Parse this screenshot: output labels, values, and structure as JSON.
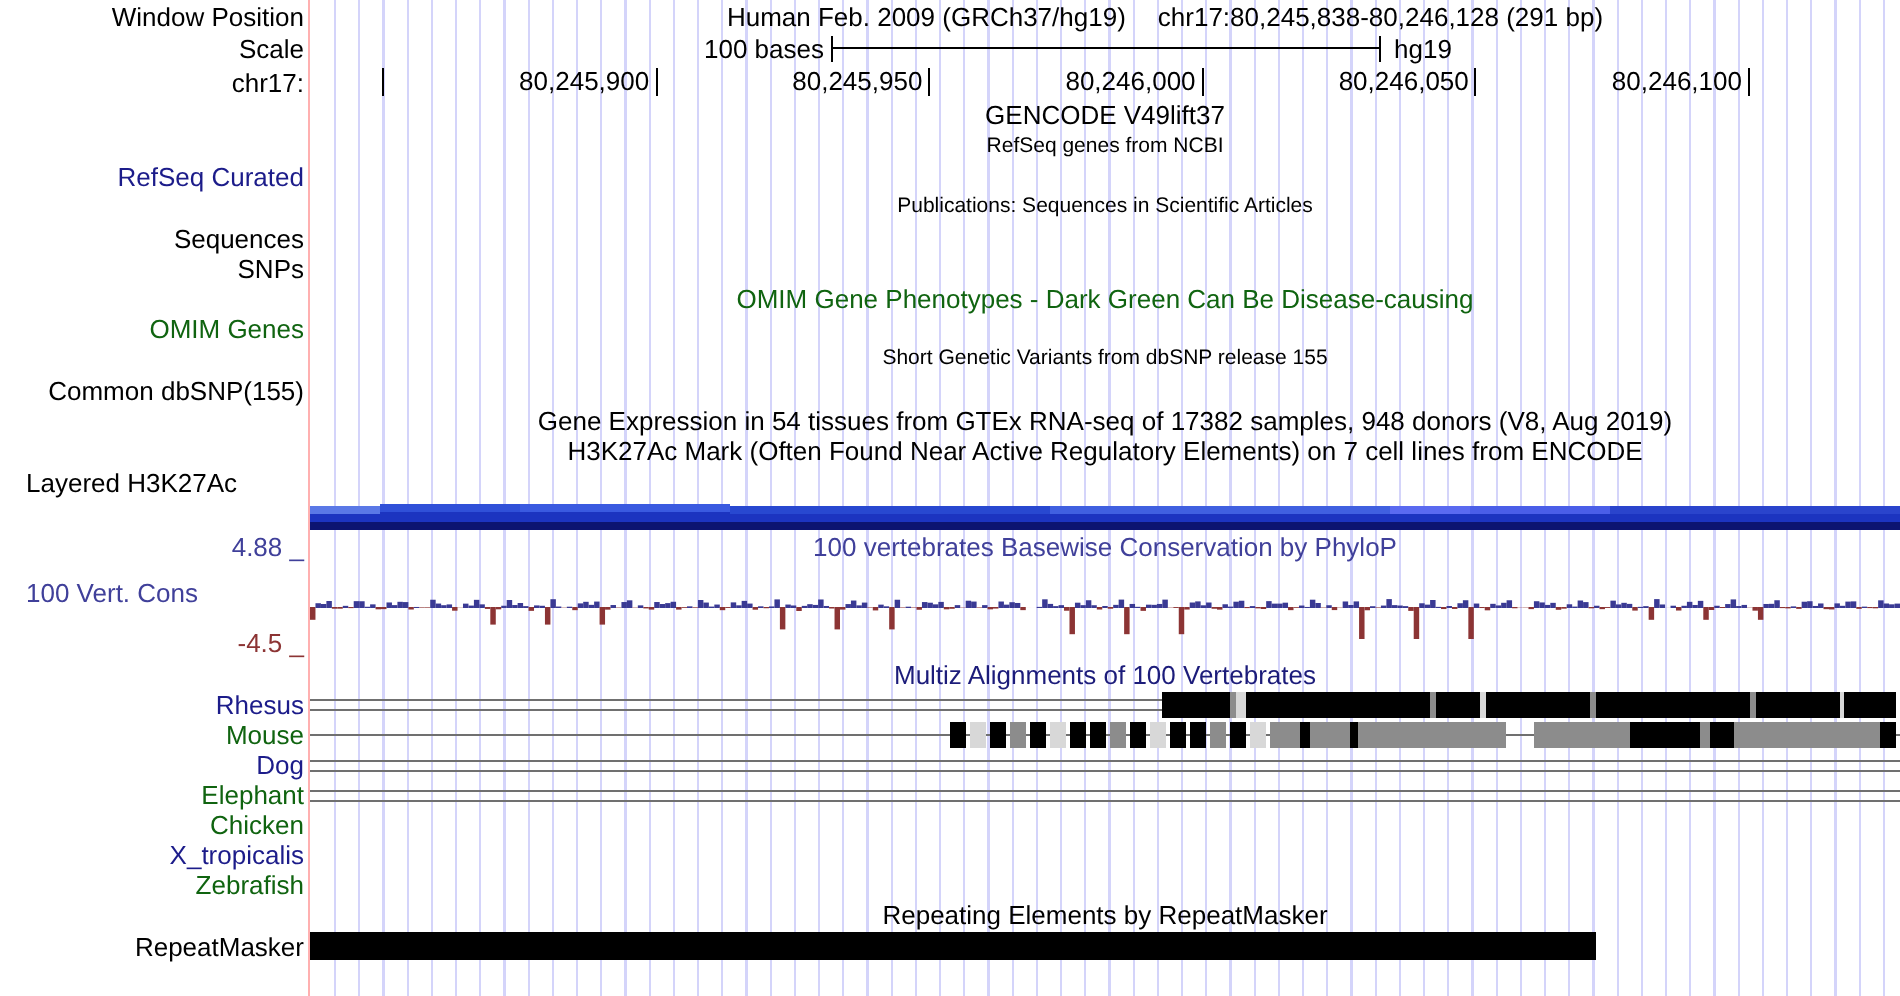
{
  "header": {
    "label": "Window Position",
    "assembly": "Human Feb. 2009 (GRCh37/hg19)",
    "position": "chr17:80,245,838-80,246,128 (291 bp)"
  },
  "scale": {
    "label": "Scale",
    "length": "100 bases",
    "assembly": "hg19"
  },
  "ruler": {
    "label": "chr17:",
    "ticks": [
      "80,245,900",
      "80,245,950",
      "80,246,000",
      "80,246,050",
      "80,246,100"
    ]
  },
  "rows": [
    {
      "kind": "title",
      "title": "GENCODE V49lift37",
      "color": "#000000"
    },
    {
      "kind": "note",
      "title": "RefSeq genes from NCBI"
    },
    {
      "kind": "label",
      "label": "RefSeq Curated",
      "color": "#1c1c8a"
    },
    {
      "kind": "note",
      "title": "Publications: Sequences in Scientific Articles"
    },
    {
      "kind": "label",
      "label": "Sequences",
      "color": "#000000"
    },
    {
      "kind": "label",
      "label": "SNPs",
      "color": "#000000"
    },
    {
      "kind": "title",
      "title": "OMIM Gene Phenotypes - Dark Green Can Be Disease-causing",
      "color": "#106410"
    },
    {
      "kind": "label",
      "label": "OMIM Genes",
      "color": "#106410"
    },
    {
      "kind": "note",
      "title": "Short Genetic Variants from dbSNP release 155"
    },
    {
      "kind": "label",
      "label": "Common dbSNP(155)",
      "color": "#000000"
    },
    {
      "kind": "title",
      "title": "Gene Expression in 54 tissues from GTEx RNA-seq of 17382 samples, 948 donors (V8, Aug 2019)",
      "color": "#000000"
    },
    {
      "kind": "title",
      "title": "H3K27Ac Mark (Often Found Near Active Regulatory Elements) on 7 cell lines from ENCODE",
      "color": "#000000"
    },
    {
      "kind": "group",
      "label": "Layered H3K27Ac",
      "color": "#000000"
    },
    {
      "kind": "signal"
    },
    {
      "kind": "wiggle",
      "max": "4.88 _",
      "title": "100 vertebrates Basewise Conservation by PhyloP",
      "label": "100 Vert. Cons",
      "min": "-4.5 _",
      "color": "#40409a"
    },
    {
      "kind": "alignment",
      "title": "Multiz Alignments of 100 Vertebrates",
      "color": "#1c1c7a",
      "species": [
        {
          "name": "Rhesus",
          "color": "#1c1c8a"
        },
        {
          "name": "Mouse",
          "color": "#106410"
        },
        {
          "name": "Dog",
          "color": "#1c1c8a"
        },
        {
          "name": "Elephant",
          "color": "#106410"
        },
        {
          "name": "Chicken",
          "color": "#106410"
        },
        {
          "name": "X_tropicalis",
          "color": "#1c1c8a"
        },
        {
          "name": "Zebrafish",
          "color": "#106410"
        }
      ]
    },
    {
      "kind": "title",
      "title": "Repeating Elements by RepeatMasker",
      "color": "#000000"
    },
    {
      "kind": "feature",
      "label": "RepeatMasker"
    }
  ]
}
